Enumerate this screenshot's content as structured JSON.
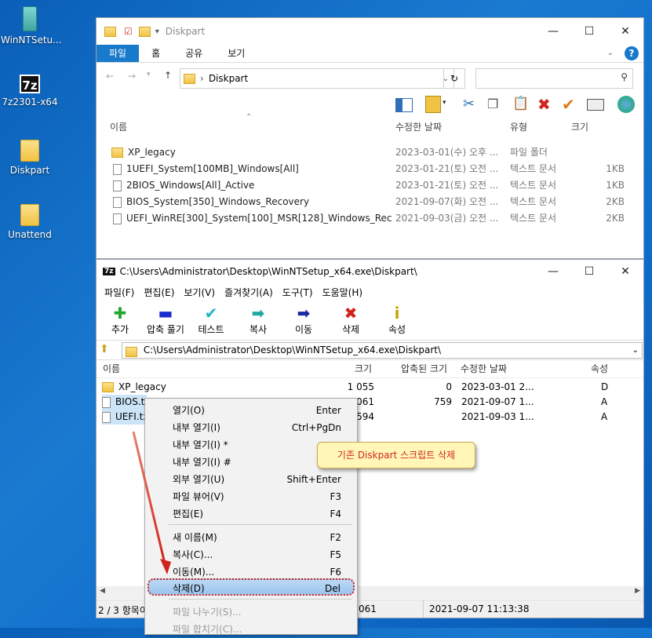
{
  "desktop": {
    "icons": [
      {
        "label": "WinNTSetu..."
      },
      {
        "label": "7z2301-x64",
        "glyph": "7z"
      },
      {
        "label": "Diskpart"
      },
      {
        "label": "Unattend"
      }
    ]
  },
  "explorer": {
    "title": "Diskpart",
    "tabs": [
      "파일",
      "홈",
      "공유",
      "보기"
    ],
    "address": "Diskpart",
    "columns": {
      "name": "이름",
      "date": "수정한 날짜",
      "type": "유형",
      "size": "크기"
    },
    "rows": [
      {
        "name": "XP_legacy",
        "date": "2023-03-01(수) 오후 ...",
        "type": "파일 폴더",
        "size": ""
      },
      {
        "name": "1UEFI_System[100MB]_Windows[All]",
        "date": "2023-01-21(토) 오전 ...",
        "type": "텍스트 문서",
        "size": "1KB"
      },
      {
        "name": "2BIOS_Windows[All]_Active",
        "date": "2023-01-21(토) 오전 ...",
        "type": "텍스트 문서",
        "size": "1KB"
      },
      {
        "name": "BIOS_System[350]_Windows_Recovery",
        "date": "2021-09-07(화) 오전 ...",
        "type": "텍스트 문서",
        "size": "2KB"
      },
      {
        "name": "UEFI_WinRE[300]_System[100]_MSR[128]_Windows_Recovery",
        "date": "2021-09-03(금) 오전 ...",
        "type": "텍스트 문서",
        "size": "2KB"
      }
    ]
  },
  "sevenzip": {
    "title": "C:\\Users\\Administrator\\Desktop\\WinNTSetup_x64.exe\\Diskpart\\",
    "logo": "7z",
    "menu": [
      "파일(F)",
      "편집(E)",
      "보기(V)",
      "즐겨찾기(A)",
      "도구(T)",
      "도움말(H)"
    ],
    "toolbar": [
      {
        "label": "추가",
        "icon": "add-icon",
        "glyph": "✚",
        "color": "#22a52c"
      },
      {
        "label": "압축 풀기",
        "icon": "extract-icon",
        "glyph": "▬",
        "color": "#1b2ccc"
      },
      {
        "label": "테스트",
        "icon": "test-icon",
        "glyph": "✔",
        "color": "#1fb6c4"
      },
      {
        "label": "복사",
        "icon": "copy-icon",
        "glyph": "➡",
        "color": "#1fa8a0"
      },
      {
        "label": "이동",
        "icon": "move-icon",
        "glyph": "➡",
        "color": "#1b2a9c"
      },
      {
        "label": "삭제",
        "icon": "delete-icon",
        "glyph": "✖",
        "color": "#d0241a"
      },
      {
        "label": "속성",
        "icon": "info-icon",
        "glyph": "i",
        "color": "#c9a400"
      }
    ],
    "path": "C:\\Users\\Administrator\\Desktop\\WinNTSetup_x64.exe\\Diskpart\\",
    "columns": {
      "name": "이름",
      "size": "크기",
      "packed": "압축된 크기",
      "modified": "수정한 날짜",
      "attr": "속성"
    },
    "rows": [
      {
        "name": "XP_legacy",
        "size": "1 055",
        "packed": "0",
        "modified": "2023-03-01 2...",
        "attr": "D"
      },
      {
        "name": "BIOS.txt",
        "size": "1 061",
        "packed": "759",
        "modified": "2021-09-07 1...",
        "attr": "A"
      },
      {
        "name": "UEFI.txt",
        "size": "1 594",
        "packed": "",
        "modified": "2021-09-03 1...",
        "attr": "A"
      }
    ],
    "status": {
      "count": "2 / 3 항목이",
      "size": "061",
      "date": "2021-09-07 11:13:38"
    }
  },
  "context_menu": {
    "items": [
      {
        "label": "열기(O)",
        "shortcut": "Enter"
      },
      {
        "label": "내부 열기(I)",
        "shortcut": "Ctrl+PgDn"
      },
      {
        "label": "내부 열기(I) *",
        "shortcut": ""
      },
      {
        "label": "내부 열기(I) #",
        "shortcut": ""
      },
      {
        "label": "외부 열기(U)",
        "shortcut": "Shift+Enter"
      },
      {
        "label": "파일 뷰어(V)",
        "shortcut": "F3"
      },
      {
        "label": "편집(E)",
        "shortcut": "F4"
      },
      {
        "label": "새 이름(M)",
        "shortcut": "F2"
      },
      {
        "label": "복사(C)...",
        "shortcut": "F5"
      },
      {
        "label": "이동(M)...",
        "shortcut": "F6"
      },
      {
        "label": "삭제(D)",
        "shortcut": "Del"
      },
      {
        "label": "파일 나누기(S)...",
        "shortcut": ""
      },
      {
        "label": "파일 합치기(C)...",
        "shortcut": ""
      }
    ]
  },
  "callout": {
    "text": "기존 Diskpart 스크립트 삭제"
  },
  "colors": {
    "accent": "#1979ca",
    "highlight_border": "#d0241a",
    "selection": "#cce4f7",
    "callout_bg": "#fff6b8"
  }
}
